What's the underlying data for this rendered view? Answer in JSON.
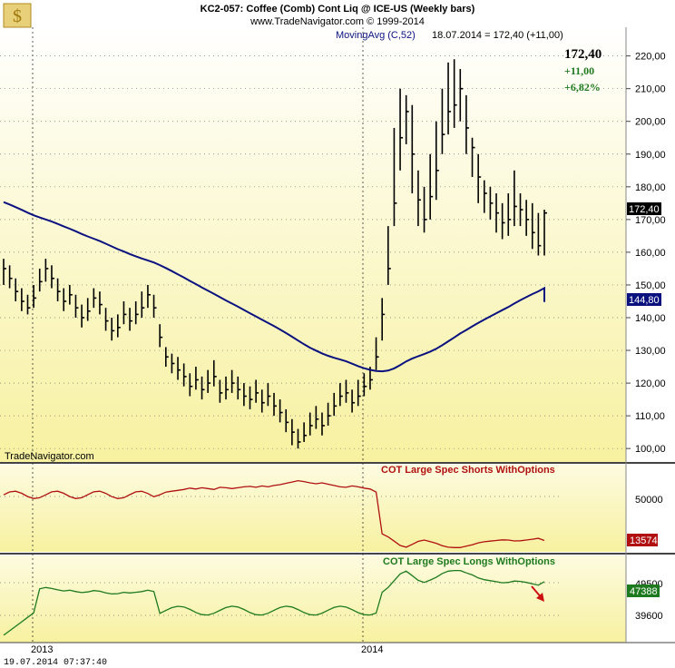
{
  "header": {
    "title_line1": "KC2-057:  Coffee (Comb) Cont Liq @ ICE-US  (Weekly bars)",
    "title_line2": "www.TradeNavigator.com © 1999-2014"
  },
  "main_panel": {
    "indicator_label": "MovingAvg (C,52)",
    "date_readout": "18.07.2014 = 172,40 (+11,00)",
    "last_price": "172,40",
    "change": "+11,00",
    "change_pct": "+6,82%",
    "last_price_tag": "172,40",
    "ma_tag": "144,80",
    "watermark": "TradeNavigator.com"
  },
  "shorts_panel": {
    "label": "COT Large Spec Shorts WithOptions",
    "tick": "50000",
    "value_tag": "13574"
  },
  "longs_panel": {
    "label": "COT Large Spec Longs WithOptions",
    "ticks": [
      "49500",
      "39600"
    ],
    "value_tag": "47388"
  },
  "x_axis": {
    "labels": [
      "2013",
      "2014"
    ]
  },
  "footer": {
    "timestamp": "19.07.2014  07:37:40"
  },
  "colors": {
    "price_bars": "#000000",
    "moving_average": "#0b1280",
    "cot_shorts": "#b01010",
    "cot_longs": "#1e7a1e",
    "change_text": "#1e7a1e",
    "panel_top": "#ffffff",
    "panel_bottom": "#f7f1a0"
  },
  "chart_data": [
    {
      "type": "line",
      "panel": "price",
      "y_ticks": [
        100,
        110,
        120,
        130,
        140,
        150,
        160,
        170,
        180,
        190,
        200,
        210,
        220
      ],
      "ylim": [
        97,
        226
      ],
      "x_start_week": "2012-07",
      "bars_close": [
        155,
        152,
        148,
        145,
        143,
        146,
        151,
        155,
        152,
        148,
        145,
        147,
        143,
        140,
        142,
        146,
        144,
        139,
        136,
        137,
        141,
        139,
        141,
        143,
        147,
        143,
        134,
        128,
        126,
        124,
        122,
        119,
        121,
        118,
        120,
        122,
        117,
        118,
        120,
        118,
        116,
        115,
        117,
        114,
        116,
        113,
        111,
        108,
        105,
        102,
        104,
        107,
        109,
        107,
        110,
        113,
        116,
        117,
        114,
        116,
        119,
        121,
        128,
        141,
        155,
        175,
        195,
        203,
        190,
        176,
        170,
        177,
        185,
        196,
        203,
        205,
        210,
        198,
        192,
        183,
        178,
        175,
        172,
        169,
        170,
        174,
        173,
        170,
        166,
        162,
        172
      ],
      "bars_high": [
        158,
        156,
        152,
        149,
        147,
        150,
        155,
        158,
        156,
        152,
        149,
        150,
        147,
        144,
        146,
        149,
        148,
        143,
        140,
        141,
        145,
        143,
        145,
        148,
        150,
        147,
        138,
        131,
        129,
        128,
        126,
        123,
        125,
        122,
        124,
        127,
        121,
        122,
        124,
        122,
        120,
        119,
        121,
        118,
        120,
        117,
        115,
        112,
        109,
        106,
        108,
        111,
        113,
        111,
        114,
        117,
        120,
        121,
        118,
        121,
        123,
        125,
        134,
        146,
        168,
        198,
        210,
        208,
        205,
        185,
        180,
        190,
        200,
        210,
        218,
        219,
        216,
        208,
        195,
        190,
        182,
        180,
        178,
        175,
        178,
        185,
        178,
        176,
        175,
        172,
        173
      ],
      "bars_low": [
        150,
        149,
        145,
        142,
        141,
        143,
        148,
        151,
        149,
        145,
        142,
        144,
        140,
        137,
        139,
        143,
        141,
        136,
        133,
        134,
        138,
        136,
        138,
        140,
        143,
        140,
        131,
        125,
        123,
        121,
        119,
        116,
        118,
        115,
        117,
        119,
        114,
        115,
        117,
        115,
        113,
        112,
        114,
        111,
        113,
        110,
        108,
        105,
        101,
        100,
        102,
        104,
        106,
        104,
        107,
        110,
        113,
        114,
        111,
        113,
        116,
        118,
        124,
        133,
        150,
        168,
        185,
        193,
        178,
        168,
        166,
        170,
        176,
        190,
        196,
        198,
        200,
        190,
        183,
        175,
        172,
        170,
        166,
        164,
        165,
        168,
        168,
        165,
        161,
        159,
        159
      ],
      "series": [
        {
          "name": "MovingAvg (C,52)",
          "role": "moving_average",
          "last": 144.8
        }
      ],
      "last_value": 172.4
    },
    {
      "type": "line",
      "panel": "cot_shorts",
      "series": [
        {
          "name": "COT Large Spec Shorts WithOptions",
          "last": 13574
        }
      ],
      "y_ticks": [
        50000
      ]
    },
    {
      "type": "line",
      "panel": "cot_longs",
      "series": [
        {
          "name": "COT Large Spec Longs WithOptions",
          "last": 47388
        }
      ],
      "y_ticks": [
        49500,
        39600
      ]
    }
  ]
}
